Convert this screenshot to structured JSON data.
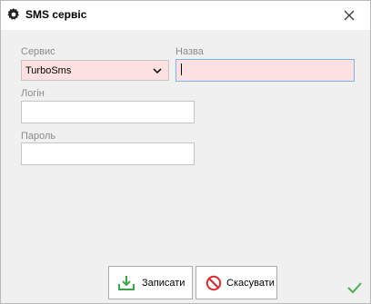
{
  "window": {
    "title": "SMS сервіс",
    "title_icon": "gear-icon",
    "close_icon": "close-icon"
  },
  "form": {
    "service": {
      "label": "Сервис",
      "value": "TurboSms",
      "icon": "chevron-down-icon"
    },
    "name": {
      "label": "Назва",
      "value": ""
    },
    "login": {
      "label": "Логін",
      "value": ""
    },
    "password": {
      "label": "Пароль",
      "value": ""
    }
  },
  "buttons": {
    "save": {
      "label": "Записати",
      "icon": "save-download-icon"
    },
    "cancel": {
      "label": "Скасувати",
      "icon": "cancel-icon"
    }
  },
  "status": {
    "icon": "checkmark-icon"
  },
  "colors": {
    "required_field_bg": "#fde1e1",
    "save_icon": "#3aa54a",
    "cancel_icon": "#e0262b",
    "check_mark": "#4caf50",
    "focus_border": "#7eb4ea"
  }
}
